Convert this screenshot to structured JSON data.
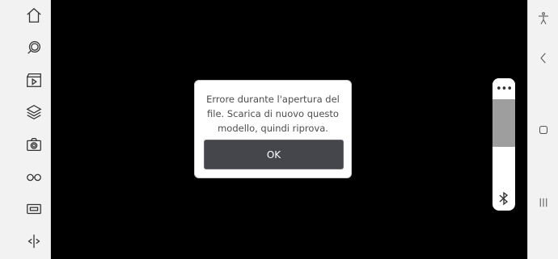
{
  "dialog": {
    "message": "Errore durante l'apertura del file. Scarica di nuovo questo modello, quindi riprova.",
    "ok_label": "OK"
  },
  "slider": {
    "menu_glyph": "•••",
    "fill_fraction": 0.48
  },
  "left_nav_icons": [
    "home-icon",
    "search-icon",
    "video-clip-icon",
    "layers-icon",
    "camera-icon",
    "glasses-icon",
    "ar-frame-icon",
    "compare-icon"
  ],
  "system_icons": [
    "accessibility-icon",
    "back-chevron-icon",
    "home-square-icon",
    "recent-apps-icon"
  ],
  "colors": {
    "background": "#000000",
    "sidebar": "#f2f2f3",
    "dialog_button": "#45464b",
    "slider_fill": "#9e9e9e"
  }
}
